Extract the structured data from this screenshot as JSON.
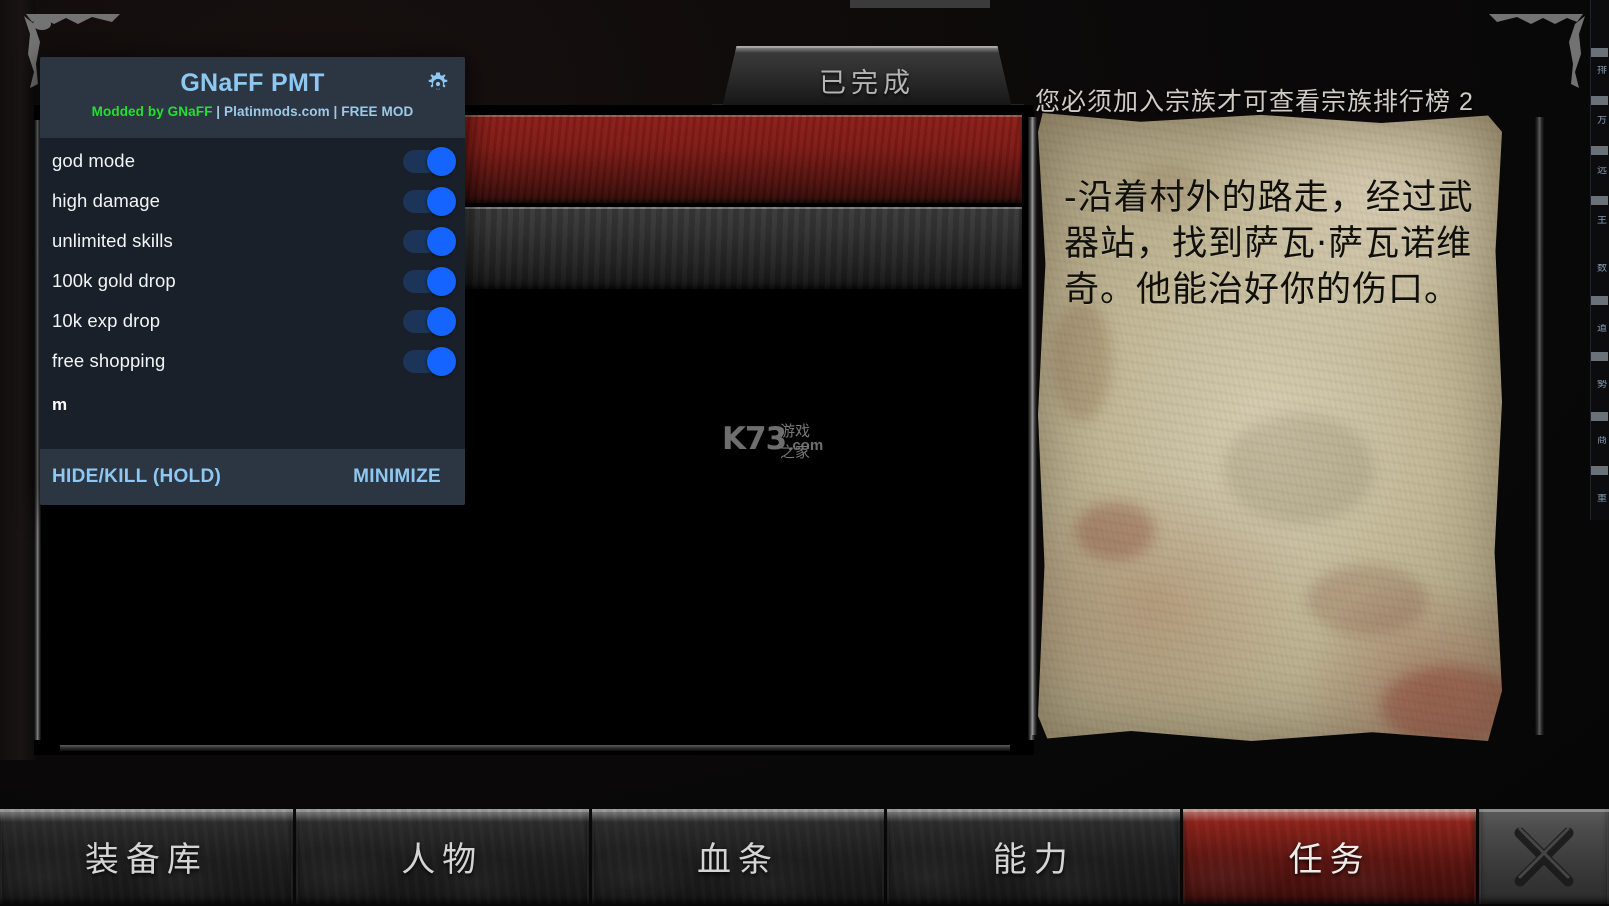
{
  "game": {
    "completed_banner": "已完成",
    "notification": "您必须加入宗族才可查看宗族排行榜 2",
    "quest_text": "-沿着村外的路走，经过武器站，找到萨瓦·萨瓦诺维奇。他能治好你的伤口。",
    "watermark": {
      "logo": "K73",
      "domain": ".com",
      "cn": "游戏之家"
    },
    "nav_tabs": [
      {
        "label": "装备库",
        "active": false
      },
      {
        "label": "人物",
        "active": false
      },
      {
        "label": "血条",
        "active": false
      },
      {
        "label": "能力",
        "active": false
      },
      {
        "label": "任务",
        "active": true
      }
    ],
    "close_button_icon": "x-icon"
  },
  "mod_panel": {
    "title": "GNaFF PMT",
    "gear_icon": "gear-icon",
    "credit": {
      "author": "Modded by GNaFF",
      "site": " | Platinmods.com | FREE MOD"
    },
    "toggles": [
      {
        "label": "god mode",
        "on": true
      },
      {
        "label": "high damage",
        "on": true
      },
      {
        "label": "unlimited skills",
        "on": true
      },
      {
        "label": "100k gold drop",
        "on": true
      },
      {
        "label": "10k exp drop",
        "on": true
      },
      {
        "label": "free shopping",
        "on": true
      }
    ],
    "note": "m",
    "footer": {
      "hide_kill": "HIDE/KILL (HOLD)",
      "minimize": "MINIMIZE"
    },
    "colors": {
      "panel_bg": "#1a2029",
      "header_bg": "#2c3642",
      "title": "#8ec8f2",
      "accent_green": "#22e033",
      "accent_blue": "#9cc9ea",
      "toggle_on": "#1464ff",
      "toggle_track": "#1b3458"
    }
  }
}
